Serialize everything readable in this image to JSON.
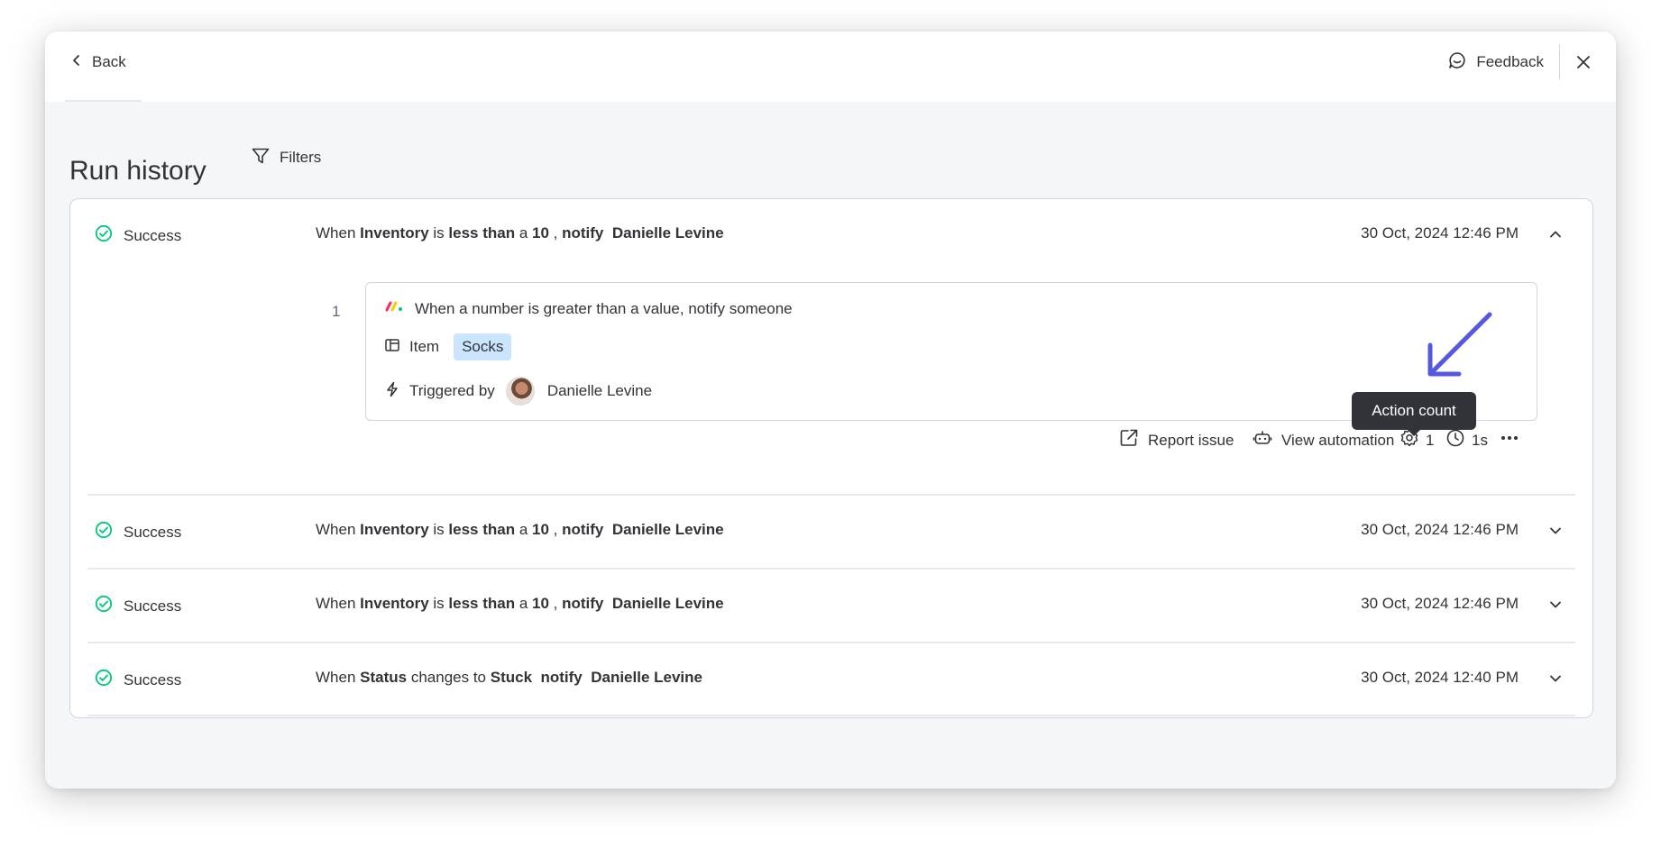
{
  "header": {
    "back_label": "Back",
    "feedback_label": "Feedback"
  },
  "page": {
    "title": "Run history",
    "filters_label": "Filters"
  },
  "runs": [
    {
      "status": "Success",
      "parts": [
        "When ",
        "Inventory",
        " is ",
        "less than",
        " a ",
        "10",
        " , ",
        "notify",
        "  ",
        "Danielle Levine"
      ],
      "date": "30 Oct, 2024 12:46 PM",
      "expanded": true
    },
    {
      "status": "Success",
      "parts": [
        "When ",
        "Inventory",
        " is ",
        "less than",
        " a ",
        "10",
        " , ",
        "notify",
        "  ",
        "Danielle Levine"
      ],
      "date": "30 Oct, 2024 12:46 PM",
      "expanded": false
    },
    {
      "status": "Success",
      "parts": [
        "When ",
        "Inventory",
        " is ",
        "less than",
        " a ",
        "10",
        " , ",
        "notify",
        "  ",
        "Danielle Levine"
      ],
      "date": "30 Oct, 2024 12:46 PM",
      "expanded": false
    },
    {
      "status": "Success",
      "parts": [
        "When ",
        "Status",
        " changes to ",
        "Stuck",
        "  ",
        "notify",
        "  ",
        "Danielle Levine"
      ],
      "date": "30 Oct, 2024 12:40 PM",
      "expanded": false
    }
  ],
  "detail": {
    "step_number": "1",
    "recipe": "When a number is greater than a value, notify someone",
    "item_label": "Item",
    "item_tag": "Socks",
    "triggered_label": "Triggered by",
    "triggered_user": "Danielle Levine"
  },
  "actions": {
    "report_issue": "Report issue",
    "view_automation": "View automation",
    "action_count": "1",
    "duration": "1s",
    "tooltip": "Action count"
  },
  "colors": {
    "success": "#00c875",
    "tag_bg": "#cce5ff",
    "annotation_arrow": "#5559df"
  }
}
